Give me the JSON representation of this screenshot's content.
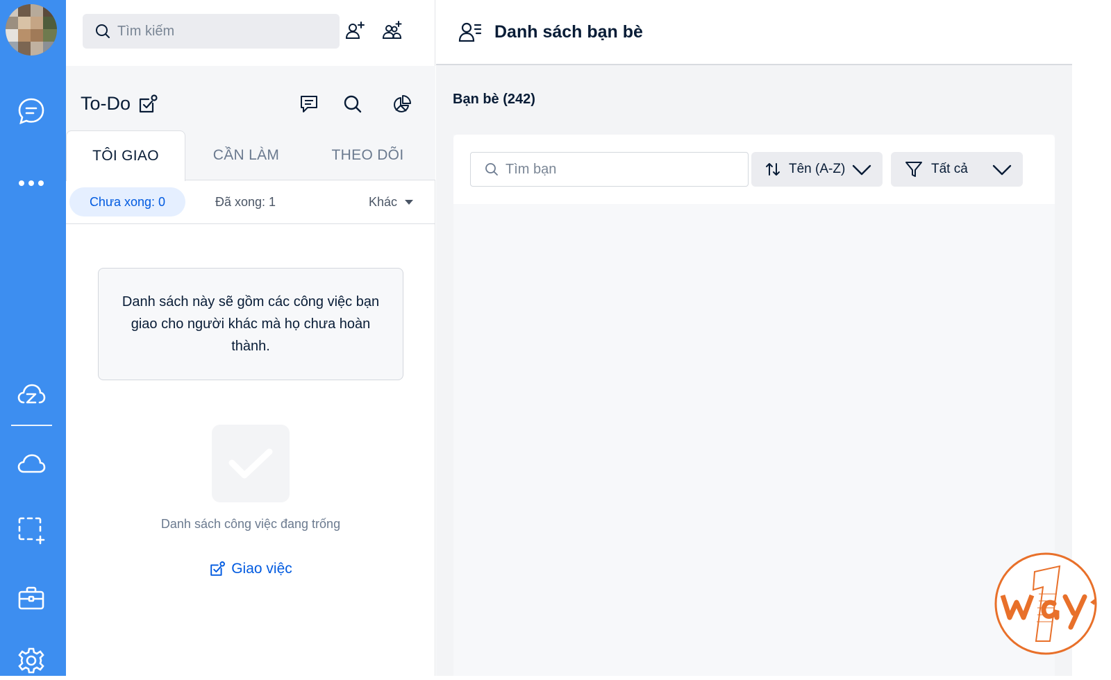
{
  "sidebar": {
    "items": [
      {
        "name": "messages",
        "icon": "chat-bubble-icon"
      },
      {
        "name": "more",
        "icon": "more-dots-icon"
      },
      {
        "name": "zcloud",
        "icon": "zcloud-icon"
      },
      {
        "name": "cloud",
        "icon": "cloud-icon"
      },
      {
        "name": "screenshot",
        "icon": "screen-capture-icon"
      },
      {
        "name": "toolbox",
        "icon": "briefcase-icon"
      },
      {
        "name": "settings",
        "icon": "gear-icon"
      }
    ],
    "accent": "#3d8ef0"
  },
  "search": {
    "placeholder": "Tìm kiếm"
  },
  "todo": {
    "title": "To-Do",
    "tabs": [
      {
        "label": "TÔI GIAO",
        "active": true
      },
      {
        "label": "CẦN LÀM",
        "active": false
      },
      {
        "label": "THEO DÕI",
        "active": false
      }
    ],
    "subtabs": {
      "pending": "Chưa xong: 0",
      "done": "Đã xong: 1",
      "other": "Khác"
    },
    "info": "Danh sách này sẽ gồm các công việc bạn giao cho người khác mà họ chưa hoàn thành.",
    "empty_text": "Danh sách công việc đang trống",
    "assign_label": "Giao việc"
  },
  "friends": {
    "header_title": "Danh sách bạn bè",
    "count_label": "Bạn bè (242)",
    "search_placeholder": "Tìm bạn",
    "sort_label": "Tên (A-Z)",
    "filter_label": "Tất cả"
  },
  "colors": {
    "link": "#005ae0",
    "pill_bg": "#e5efff",
    "watermark": "#e8702a"
  }
}
